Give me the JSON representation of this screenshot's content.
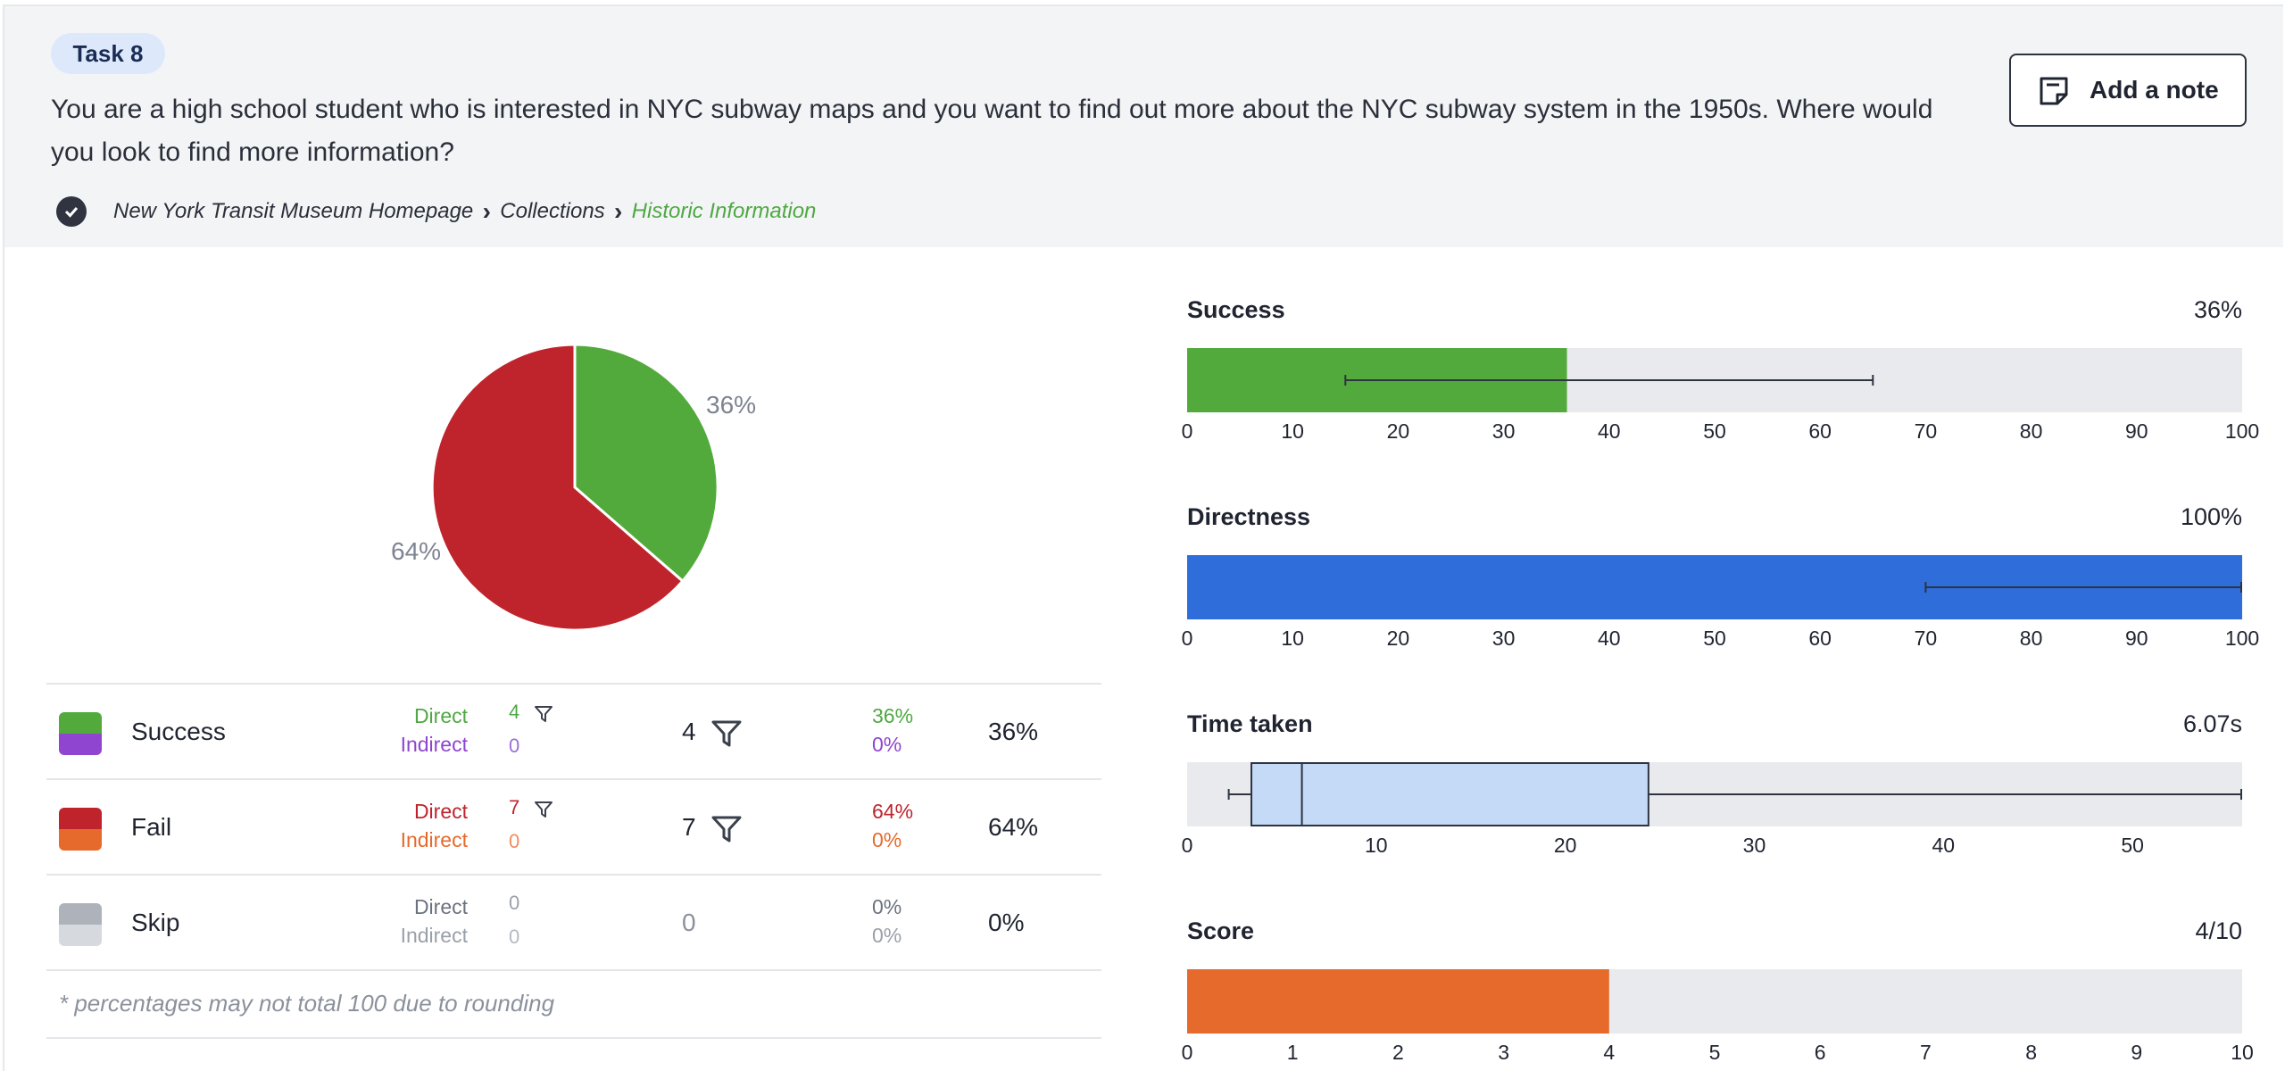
{
  "header": {
    "task_label": "Task 8",
    "question": "You are a high school student who is interested in NYC subway maps and you want to find out more about the NYC subway system in the 1950s. Where would you look to find more information?",
    "add_note_label": "Add a note",
    "breadcrumbs": [
      "New York Transit Museum Homepage",
      "Collections",
      "Historic Information"
    ]
  },
  "pie": {
    "slices": [
      {
        "label": "Success",
        "value": 36,
        "color": "#52aa3c",
        "text": "36%"
      },
      {
        "label": "Fail",
        "value": 64,
        "color": "#bf242c",
        "text": "64%"
      }
    ]
  },
  "table": {
    "rows": [
      {
        "name": "Success",
        "direct_label": "Direct",
        "indirect_label": "Indirect",
        "direct_count": "4",
        "indirect_count": "0",
        "total": "4",
        "direct_pct": "36%",
        "indirect_pct": "0%",
        "pct": "36%",
        "colors": {
          "direct": "#52aa3c",
          "indirect": "#8f45cf"
        }
      },
      {
        "name": "Fail",
        "direct_label": "Direct",
        "indirect_label": "Indirect",
        "direct_count": "7",
        "indirect_count": "0",
        "total": "7",
        "direct_pct": "64%",
        "indirect_pct": "0%",
        "pct": "64%",
        "colors": {
          "direct": "#bf242c",
          "indirect": "#e66a2c"
        }
      },
      {
        "name": "Skip",
        "direct_label": "Direct",
        "indirect_label": "Indirect",
        "direct_count": "0",
        "indirect_count": "0",
        "total": "0",
        "direct_pct": "0%",
        "indirect_pct": "0%",
        "pct": "0%",
        "colors": {
          "direct": "#aeb3bb",
          "indirect": "#d6d9de"
        }
      }
    ],
    "footnote": "* percentages may not total 100 due to rounding"
  },
  "metrics": {
    "success": {
      "title": "Success",
      "value": "36%",
      "bar": 36,
      "ci": [
        15,
        65
      ],
      "axis": [
        0,
        100
      ],
      "ticks": [
        "0",
        "10",
        "20",
        "30",
        "40",
        "50",
        "60",
        "70",
        "80",
        "90",
        "100"
      ],
      "color": "#52aa3c"
    },
    "directness": {
      "title": "Directness",
      "value": "100%",
      "bar": 100,
      "ci": [
        70,
        100
      ],
      "axis": [
        0,
        100
      ],
      "ticks": [
        "0",
        "10",
        "20",
        "30",
        "40",
        "50",
        "60",
        "70",
        "80",
        "90",
        "100"
      ],
      "color": "#2f6ddb"
    },
    "time": {
      "title": "Time taken",
      "value": "6.07s",
      "median": 6.07,
      "q1": 3.4,
      "q3": 24.4,
      "whisker_min": 2.2,
      "whisker_max": 55.8,
      "axis": [
        0,
        55.8
      ],
      "ticks": [
        "0",
        "10",
        "20",
        "30",
        "40",
        "50"
      ],
      "color": "#c5daf7"
    },
    "score": {
      "title": "Score",
      "value": "4/10",
      "bar": 4,
      "axis": [
        0,
        10
      ],
      "ticks": [
        "0",
        "1",
        "2",
        "3",
        "4",
        "5",
        "6",
        "7",
        "8",
        "9",
        "10"
      ],
      "color": "#e66a2c"
    }
  }
}
